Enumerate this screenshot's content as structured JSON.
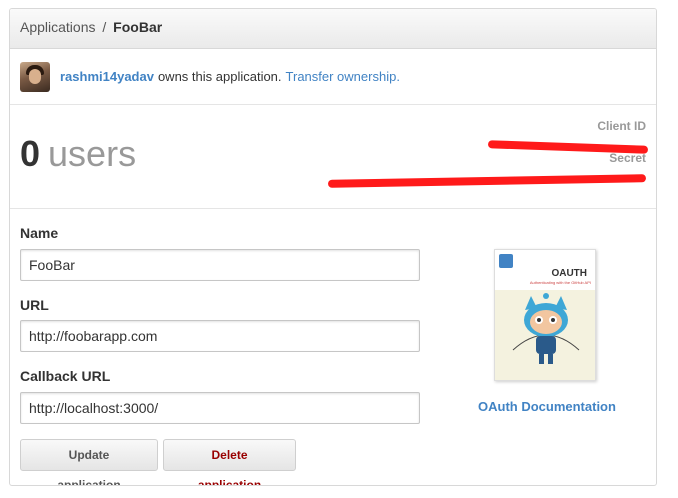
{
  "breadcrumb": {
    "parent": "Applications",
    "separator": "/",
    "current": "FooBar"
  },
  "owner": {
    "username": "rashmi14yadav",
    "text": "owns this application.",
    "transfer_link": "Transfer ownership."
  },
  "stats": {
    "count": "0",
    "unit": "users",
    "client_id_label": "Client ID",
    "secret_label": "Secret"
  },
  "form": {
    "name_label": "Name",
    "name_value": "FooBar",
    "url_label": "URL",
    "url_value": "http://foobarapp.com",
    "callback_label": "Callback URL",
    "callback_value": "http://localhost:3000/",
    "update_button": "Update application",
    "delete_button": "Delete application"
  },
  "sidebar": {
    "book_title": "OAUTH",
    "book_subtitle": "Authenticating with the GitHub API",
    "doc_link": "OAuth Documentation"
  },
  "colors": {
    "link": "#4183c4",
    "danger": "#990000",
    "redaction": "#ff1a1a"
  }
}
